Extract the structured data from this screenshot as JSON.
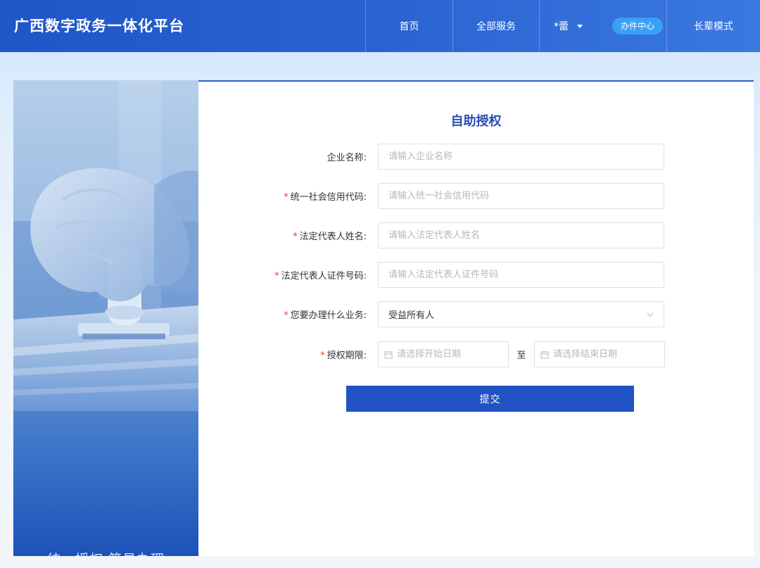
{
  "header": {
    "logo": "广西数字政务一体化平台",
    "nav": {
      "home": "首页",
      "all_services": "全部服务",
      "user_name": "*蕾",
      "office_center": "办件中心",
      "elder_mode": "长辈模式"
    }
  },
  "banner": {
    "slogan": "统一授权  简易办理"
  },
  "form": {
    "title": "自助授权",
    "fields": {
      "company_name": {
        "label": "企业名称:",
        "placeholder": "请输入企业名称",
        "required": false
      },
      "credit_code": {
        "label": "统一社会信用代码:",
        "placeholder": "请输入统一社会信用代码",
        "required": true
      },
      "legal_rep_name": {
        "label": "法定代表人姓名:",
        "placeholder": "请输入法定代表人姓名",
        "required": true
      },
      "legal_rep_id": {
        "label": "法定代表人证件号码:",
        "placeholder": "请输入法定代表人证件号码",
        "required": true
      },
      "business": {
        "label": "您要办理什么业务:",
        "value": "受益所有人",
        "required": true
      },
      "period": {
        "label": "授权期限:",
        "start_placeholder": "请选择开始日期",
        "separator": "至",
        "end_placeholder": "请选择结束日期",
        "required": true
      }
    },
    "required_mark": "*",
    "submit_label": "提交"
  },
  "colors": {
    "header_blue": "#1f56c8",
    "accent": "#2153c4",
    "required": "#e8412c",
    "title": "#2a4fb8",
    "pill": "#39a0f5"
  },
  "icons": {
    "calendar": "calendar-icon",
    "dropdown": "chevron-down-icon",
    "user_caret": "caret-down-icon"
  }
}
